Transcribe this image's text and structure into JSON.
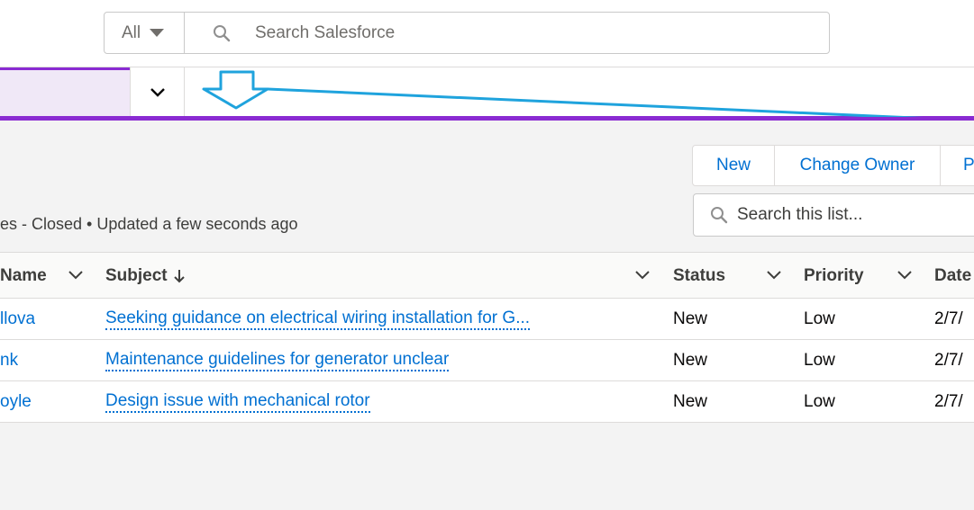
{
  "header": {
    "scope_label": "All",
    "search_placeholder": "Search Salesforce"
  },
  "list": {
    "subtitle": "es - Closed • Updated a few seconds ago",
    "buttons": {
      "new": "New",
      "change_owner": "Change Owner",
      "more": "P"
    },
    "search_placeholder": "Search this list..."
  },
  "table": {
    "columns": {
      "name": "Name",
      "subject": "Subject",
      "status": "Status",
      "priority": "Priority",
      "date": "Date"
    },
    "rows": [
      {
        "name": "llova",
        "subject": "Seeking guidance on electrical wiring installation for G...",
        "status": "New",
        "priority": "Low",
        "date": "2/7/"
      },
      {
        "name": "nk",
        "subject": "Maintenance guidelines for generator unclear",
        "status": "New",
        "priority": "Low",
        "date": "2/7/"
      },
      {
        "name": "oyle",
        "subject": "Design issue with mechanical rotor",
        "status": "New",
        "priority": "Low",
        "date": "2/7/"
      }
    ]
  },
  "colors": {
    "accent_purple": "#8a2bd2",
    "link_blue": "#0070d2",
    "annotation_blue": "#1fa3dd"
  }
}
